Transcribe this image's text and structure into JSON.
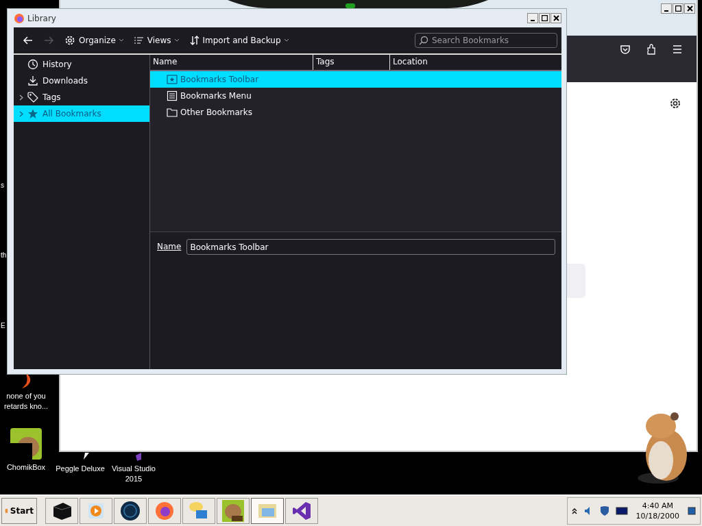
{
  "desktop": {
    "icons": [
      {
        "label": "none of you retards kno...",
        "kind": "flame"
      },
      {
        "label": "ChomikBox",
        "kind": "chomik"
      },
      {
        "label": "Peggle Deluxe",
        "kind": "peggle"
      },
      {
        "label": "Visual Studio 2015",
        "kind": "vs"
      }
    ],
    "cut_labels": [
      "s",
      "th",
      "E"
    ]
  },
  "library": {
    "title": "Library",
    "nav": {
      "back_disabled": false,
      "forward_disabled": true
    },
    "toolbar": [
      {
        "label": "Organize",
        "kind": "gear"
      },
      {
        "label": "Views",
        "kind": "list"
      },
      {
        "label": "Import and Backup",
        "kind": "sort"
      }
    ],
    "search": {
      "placeholder": "Search Bookmarks"
    },
    "sidebar": [
      {
        "label": "History",
        "kind": "history",
        "expandable": false,
        "selected": false
      },
      {
        "label": "Downloads",
        "kind": "downloads",
        "expandable": false,
        "selected": false
      },
      {
        "label": "Tags",
        "kind": "tags",
        "expandable": true,
        "selected": false
      },
      {
        "label": "All Bookmarks",
        "kind": "star",
        "expandable": true,
        "selected": true
      }
    ],
    "columns": [
      "Name",
      "Tags",
      "Location"
    ],
    "rows": [
      {
        "name": "Bookmarks Toolbar",
        "kind": "toolbar",
        "selected": true
      },
      {
        "name": "Bookmarks Menu",
        "kind": "menu",
        "selected": false
      },
      {
        "name": "Other Bookmarks",
        "kind": "folder",
        "selected": false
      }
    ],
    "details": {
      "label": "Name",
      "value": "Bookmarks Toolbar"
    }
  },
  "taskbar": {
    "start": "Start",
    "apps": [
      {
        "kind": "box",
        "selected": false
      },
      {
        "kind": "player",
        "selected": false
      },
      {
        "kind": "globe",
        "selected": false
      },
      {
        "kind": "firefox",
        "selected": false
      },
      {
        "kind": "chat",
        "selected": false
      },
      {
        "kind": "chomik",
        "selected": false
      },
      {
        "kind": "mail",
        "selected": true
      },
      {
        "kind": "vs",
        "selected": false
      }
    ],
    "time": "4:40 AM",
    "date": "10/18/2000"
  }
}
